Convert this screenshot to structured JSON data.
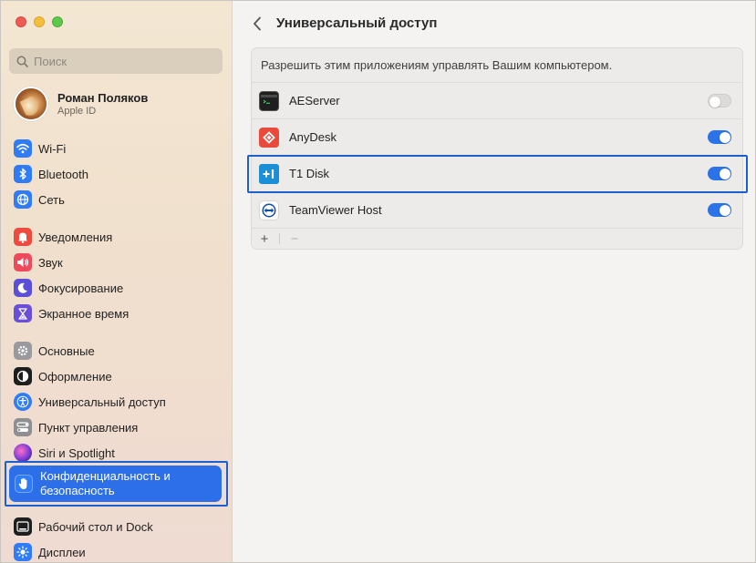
{
  "window": {
    "traffic_lights": [
      "close",
      "minimize",
      "zoom"
    ]
  },
  "sidebar": {
    "search": {
      "placeholder": "Поиск",
      "value": ""
    },
    "profile": {
      "name": "Роман Поляков",
      "subtitle": "Apple ID"
    },
    "items": [
      {
        "label": "Wi-Fi",
        "icon": "wifi-icon",
        "color": "#2f7cf6"
      },
      {
        "label": "Bluetooth",
        "icon": "bluetooth-icon",
        "color": "#2f7cf6"
      },
      {
        "label": "Сеть",
        "icon": "globe-icon",
        "color": "#2f7cf6"
      },
      {
        "label": "Уведомления",
        "icon": "bell-icon",
        "color": "#ef4a3e"
      },
      {
        "label": "Звук",
        "icon": "speaker-icon",
        "color": "#ef4a5c"
      },
      {
        "label": "Фокусирование",
        "icon": "moon-icon",
        "color": "#5a4fd6"
      },
      {
        "label": "Экранное время",
        "icon": "hourglass-icon",
        "color": "#6b4fd6"
      },
      {
        "label": "Основные",
        "icon": "gear-icon",
        "color": "#9a9a9e"
      },
      {
        "label": "Оформление",
        "icon": "appearance-icon",
        "color": "#1e1e1e"
      },
      {
        "label": "Универсальный доступ",
        "icon": "accessibility-icon",
        "color": "#2f7cf6"
      },
      {
        "label": "Пункт управления",
        "icon": "control-center-icon",
        "color": "#8e8e93"
      },
      {
        "label": "Siri и Spotlight",
        "icon": "siri-icon",
        "color": "#b03bd6"
      },
      {
        "label": "Конфиденциальность и безопасность",
        "icon": "hand-icon",
        "color": "#2f7cf6",
        "selected": true
      },
      {
        "label": "Рабочий стол и Dock",
        "icon": "dock-icon",
        "color": "#1e1e1e"
      },
      {
        "label": "Дисплеи",
        "icon": "sun-icon",
        "color": "#2f7cf6"
      }
    ]
  },
  "main": {
    "title": "Универсальный доступ",
    "panel_header": "Разрешить этим приложениям управлять Вашим компьютером.",
    "apps": [
      {
        "name": "AEServer",
        "icon": "terminal-icon",
        "enabled": false
      },
      {
        "name": "AnyDesk",
        "icon": "anydesk-icon",
        "enabled": true
      },
      {
        "name": "T1 Disk",
        "icon": "t1-disk-icon",
        "enabled": true,
        "highlighted": true
      },
      {
        "name": "TeamViewer Host",
        "icon": "teamviewer-icon",
        "enabled": true
      }
    ],
    "footer": {
      "add_label": "+",
      "remove_label": "−"
    }
  },
  "colors": {
    "accent": "#2d73e8",
    "selection_outline": "#1d5fd1"
  }
}
